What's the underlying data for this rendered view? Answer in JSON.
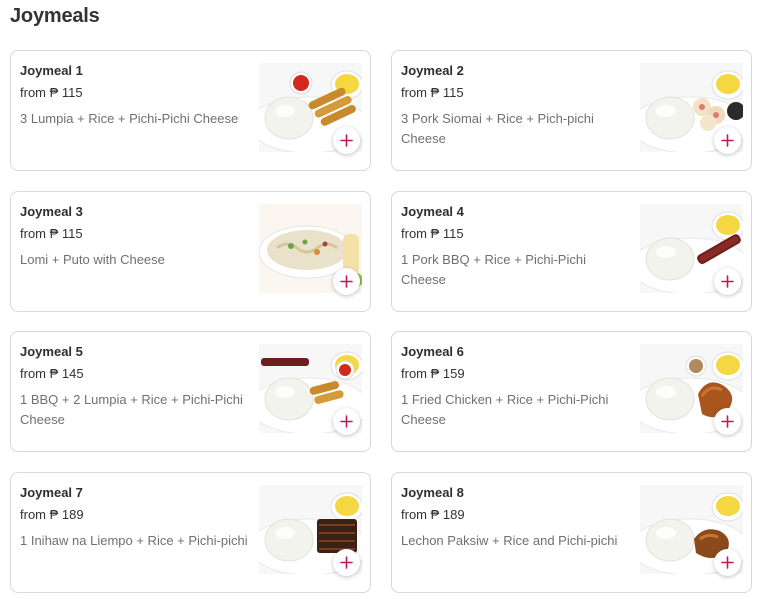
{
  "section": {
    "title": "Joymeals"
  },
  "colors": {
    "accent": "#c2185b",
    "border": "#d8d8d8",
    "muted_text": "#707070"
  },
  "items": [
    {
      "name": "Joymeal 1",
      "price": "from ₱ 115",
      "description": "3 Lumpia + Rice + Pichi-Pichi Cheese",
      "image": "lumpia-rice-plate"
    },
    {
      "name": "Joymeal 2",
      "price": "from ₱ 115",
      "description": "3 Pork Siomai + Rice + Pich-pichi Cheese",
      "image": "siomai-rice-plate"
    },
    {
      "name": "Joymeal 3",
      "price": "from ₱ 115",
      "description": "Lomi + Puto with Cheese",
      "image": "lomi-bowl"
    },
    {
      "name": "Joymeal 4",
      "price": "from ₱ 115",
      "description": "1 Pork BBQ + Rice + Pichi-Pichi Cheese",
      "image": "bbq-rice-plate"
    },
    {
      "name": "Joymeal 5",
      "price": "from ₱ 145",
      "description": "1 BBQ + 2 Lumpia + Rice + Pichi-Pichi Cheese",
      "image": "bbq-lumpia-plate"
    },
    {
      "name": "Joymeal 6",
      "price": "from ₱ 159",
      "description": "1 Fried Chicken + Rice + Pichi-Pichi Cheese",
      "image": "chicken-rice-plate"
    },
    {
      "name": "Joymeal 7",
      "price": "from ₱ 189",
      "description": "1 Inihaw na Liempo + Rice + Pichi-pichi",
      "image": "liempo-rice-plate"
    },
    {
      "name": "Joymeal 8",
      "price": "from ₱ 189",
      "description": "Lechon Paksiw + Rice and Pichi-pichi",
      "image": "paksiw-rice-plate"
    }
  ],
  "icons": {
    "add": "plus-icon"
  }
}
